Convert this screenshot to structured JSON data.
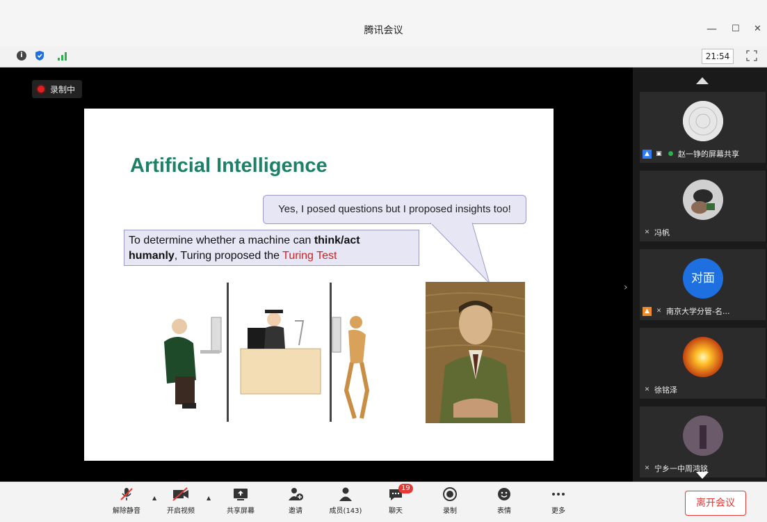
{
  "window": {
    "title": "腾讯会议",
    "minimize": "—",
    "maximize": "☐",
    "close": "✕"
  },
  "infobar": {
    "clock": "21:54"
  },
  "stage": {
    "recording_label": "录制中"
  },
  "slide": {
    "title": "Artificial Intelligence",
    "bubble_top": "Yes, I posed questions but I proposed insights too!",
    "bubble_main": {
      "part1": "To determine whether a machine can ",
      "bold1": "think/act",
      "bold2": "humanly",
      "part2": ", Turing proposed the ",
      "red": "Turing Test"
    }
  },
  "participants": [
    {
      "name": "赵一铮的屏幕共享",
      "avatar_text": ""
    },
    {
      "name": "冯帆",
      "avatar_text": ""
    },
    {
      "name": "南京大学分管-名...",
      "avatar_text": "对面"
    },
    {
      "name": "徐铭泽",
      "avatar_text": ""
    },
    {
      "name": "宁乡一中周鸿铭",
      "avatar_text": ""
    }
  ],
  "toolbar": {
    "unmute": "解除静音",
    "video": "开启视频",
    "share": "共享屏幕",
    "invite": "邀请",
    "members": "成员(143)",
    "chat": "聊天",
    "chat_badge": "19",
    "record": "录制",
    "emoji": "表情",
    "more": "更多",
    "leave": "离开会议"
  },
  "colors": {
    "accent_red": "#e53935",
    "title_green": "#1d8068",
    "link_blue": "#1e6fe0"
  }
}
